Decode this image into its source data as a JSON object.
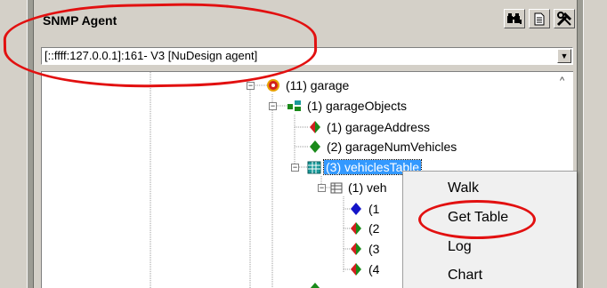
{
  "panel": {
    "title": "SNMP Agent"
  },
  "toolbar": {
    "buttons": [
      {
        "name": "find-binoculars-icon",
        "glyph": "M1"
      },
      {
        "name": "document-icon",
        "glyph": "doc"
      },
      {
        "name": "tools-icon",
        "glyph": "tools"
      }
    ]
  },
  "agent_select": {
    "value": "[::ffff:127.0.0.1]:161- V3 [NuDesign agent]"
  },
  "tree": {
    "nodes": [
      {
        "id": "garage",
        "label": "(11) garage"
      },
      {
        "id": "garage-objects",
        "label": "(1) garageObjects"
      },
      {
        "id": "garage-address",
        "label": "(1) garageAddress"
      },
      {
        "id": "garage-num-vehicles",
        "label": "(2) garageNumVehicles"
      },
      {
        "id": "vehicles-table",
        "label": "(3) vehiclesTable"
      },
      {
        "id": "vehicles-entry",
        "label": "(1) veh"
      },
      {
        "id": "col-1",
        "label": "(1"
      },
      {
        "id": "col-2",
        "label": "(2"
      },
      {
        "id": "col-3",
        "label": "(3"
      },
      {
        "id": "col-4",
        "label": "(4"
      }
    ]
  },
  "context_menu": {
    "items": [
      {
        "label": "Walk"
      },
      {
        "label": "Get Table"
      },
      {
        "label": "Log"
      },
      {
        "label": "Chart"
      }
    ]
  },
  "colors": {
    "annotation": "#e21010",
    "selection": "#3399ff",
    "leaf_green": "#1a8a1a",
    "leaf_red": "#d21f1f",
    "leaf_blue": "#1414c8",
    "table_teal": "#1a9a9a"
  }
}
